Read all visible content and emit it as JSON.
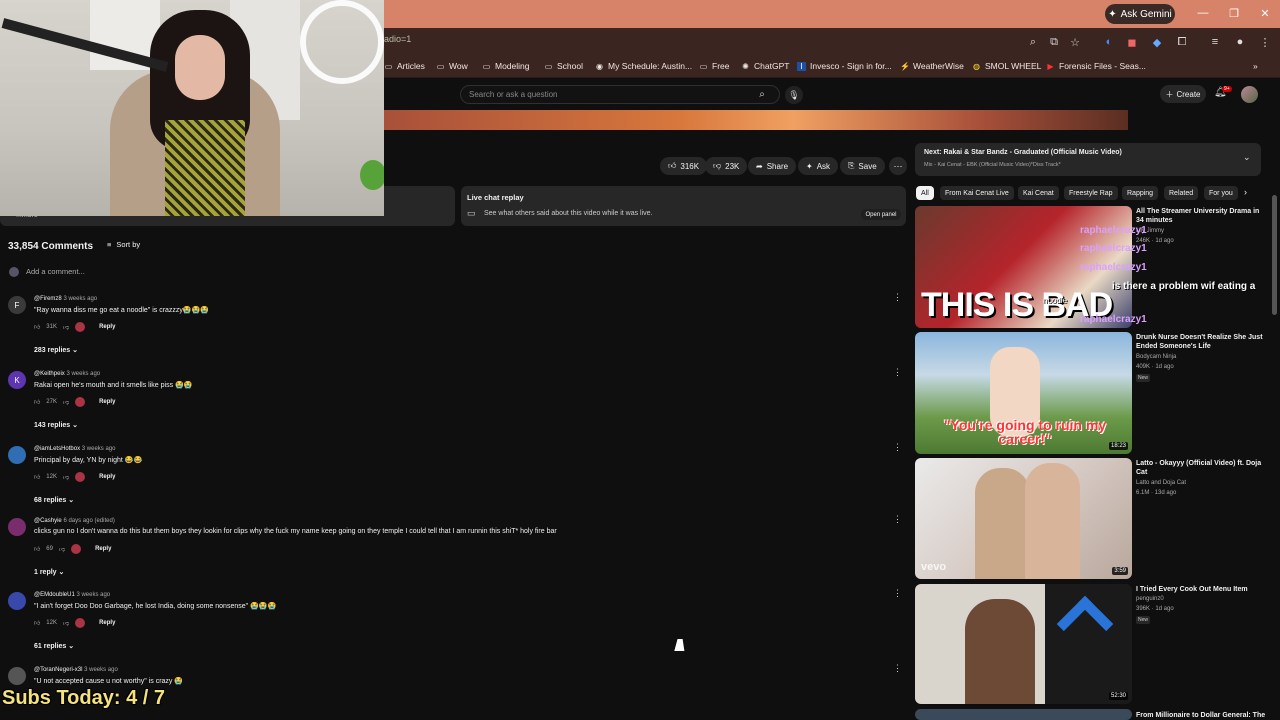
{
  "browser": {
    "ask_gemini": "Ask Gemini",
    "url_fragment": "adio=1",
    "bookmarks": [
      {
        "label": "Articles",
        "icon": "folder-icon"
      },
      {
        "label": "Wow",
        "icon": "folder-icon"
      },
      {
        "label": "Modeling",
        "icon": "folder-icon"
      },
      {
        "label": "School",
        "icon": "folder-icon"
      },
      {
        "label": "My Schedule: Austin...",
        "icon": "globe-icon"
      },
      {
        "label": "Free",
        "icon": "folder-icon"
      },
      {
        "label": "ChatGPT",
        "icon": "chatgpt-icon"
      },
      {
        "label": "Invesco - Sign in for...",
        "icon": "invesco-icon"
      },
      {
        "label": "WeatherWise",
        "icon": "weather-icon"
      },
      {
        "label": "SMOL WHEEL",
        "icon": "wheel-icon"
      },
      {
        "label": "Forensic Files - Seas...",
        "icon": "youtube-icon"
      }
    ]
  },
  "header": {
    "search_placeholder": "Search or ask a question",
    "create_label": "Create",
    "notif_count": "9+"
  },
  "actions": {
    "likes": "316K",
    "dislikes": "23K",
    "share": "Share",
    "ask": "Ask",
    "save": "Save"
  },
  "description": {
    "more": "...more"
  },
  "live_chat": {
    "title": "Live chat replay",
    "subtitle": "See what others said about this video while it was live.",
    "open_panel": "Open panel"
  },
  "comments": {
    "count_label": "33,854 Comments",
    "sort_label": "Sort by",
    "add_placeholder": "Add a comment...",
    "items": [
      {
        "avatar_letter": "F",
        "avatar_color": "#3a3a3a",
        "author": "@Firemz8",
        "ago": "3 weeks ago",
        "text": "\"Ray wanna diss me go eat a noodle\" is crazzzy😭😭😭",
        "likes": "31K",
        "replies": "283 replies"
      },
      {
        "avatar_letter": "K",
        "avatar_color": "#5e35b1",
        "author": "@Keithpeix",
        "ago": "3 weeks ago",
        "text": "Rakai open he's mouth and it smells like piss 😭😭",
        "likes": "27K",
        "replies": "143 replies"
      },
      {
        "avatar_letter": "",
        "avatar_color": "#2f6db5",
        "author": "@iamLetsHotbox",
        "ago": "3 weeks ago",
        "text": "Principal by day, YN by night 😂😂",
        "likes": "12K",
        "replies": "68 replies"
      },
      {
        "avatar_letter": "",
        "avatar_color": "#7a2d6d",
        "author": "@Cashyie",
        "ago": "6 days ago (edited)",
        "text": "clicks gun no I don't wanna do this but them boys they lookin for clips why the fuck my name keep going on they temple I could tell that I am runnin this shiT* holy fire bar",
        "likes": "69",
        "replies": "1 reply"
      },
      {
        "avatar_letter": "",
        "avatar_color": "#3949ab",
        "author": "@EMdoubleU1",
        "ago": "3 weeks ago",
        "text": "\"I ain't forget Doo Doo Garbage, he lost India, doing some nonsense\" 😭😭😭",
        "likes": "12K",
        "replies": "61 replies"
      },
      {
        "avatar_letter": "",
        "avatar_color": "#555555",
        "author": "@ToranNegeri-x3l",
        "ago": "3 weeks ago",
        "text": "\"U not accepted cause u not worthy\" is crazy 😭",
        "likes": "",
        "replies": ""
      }
    ],
    "reply_label": "Reply"
  },
  "up_next": {
    "title": "Next: Rakai & Star Bandz - Graduated (Official Music Video)",
    "subtitle": "Mix - Kai Cenat - EBK (Official Music Video)*Diss Track*"
  },
  "chips": [
    "All",
    "From Kai Cenat Live",
    "Kai Cenat",
    "Freestyle Rap",
    "Rapping",
    "Related",
    "For you"
  ],
  "recommendations": [
    {
      "title": "All The Streamer University Drama in 34 minutes",
      "channel": "Lily Jimmy",
      "meta": "246K · 1d ago",
      "duration": "",
      "new": "",
      "overlay": "THIS IS BAD"
    },
    {
      "title": "Drunk Nurse Doesn't Realize She Just Ended Someone's Life",
      "channel": "Bodycam Ninja",
      "meta": "409K · 1d ago",
      "duration": "18:23",
      "new": "New",
      "overlay": "\"You're going to ruin my career!\""
    },
    {
      "title": "Latto - Okayyy (Official Video) ft. Doja Cat",
      "channel": "Latto and Doja Cat",
      "meta": "6.1M · 13d ago",
      "duration": "3:59",
      "new": "",
      "overlay": "vevo"
    },
    {
      "title": "I Tried Every Cook Out Menu Item",
      "channel": "penguinz0",
      "meta": "396K · 1d ago",
      "duration": "52:30",
      "new": "New",
      "overlay": ""
    },
    {
      "title": "From Millionaire to Dollar General: The",
      "channel": "",
      "meta": "",
      "duration": "",
      "new": "",
      "overlay": ""
    }
  ],
  "stream_chat": [
    {
      "user": "raphaelcrazy1",
      "msg": ""
    },
    {
      "user": "raphaelcrazy1",
      "msg": ""
    },
    {
      "user": "raphaelcrazy1",
      "msg": ""
    },
    {
      "user": "",
      "msg": "is there a problem wif eating a"
    },
    {
      "user": "",
      "msg": "noodle"
    },
    {
      "user": "raphaelcrazy1",
      "msg": ""
    }
  ],
  "overlay": {
    "subs_today": "Subs Today: 4 / 7"
  }
}
